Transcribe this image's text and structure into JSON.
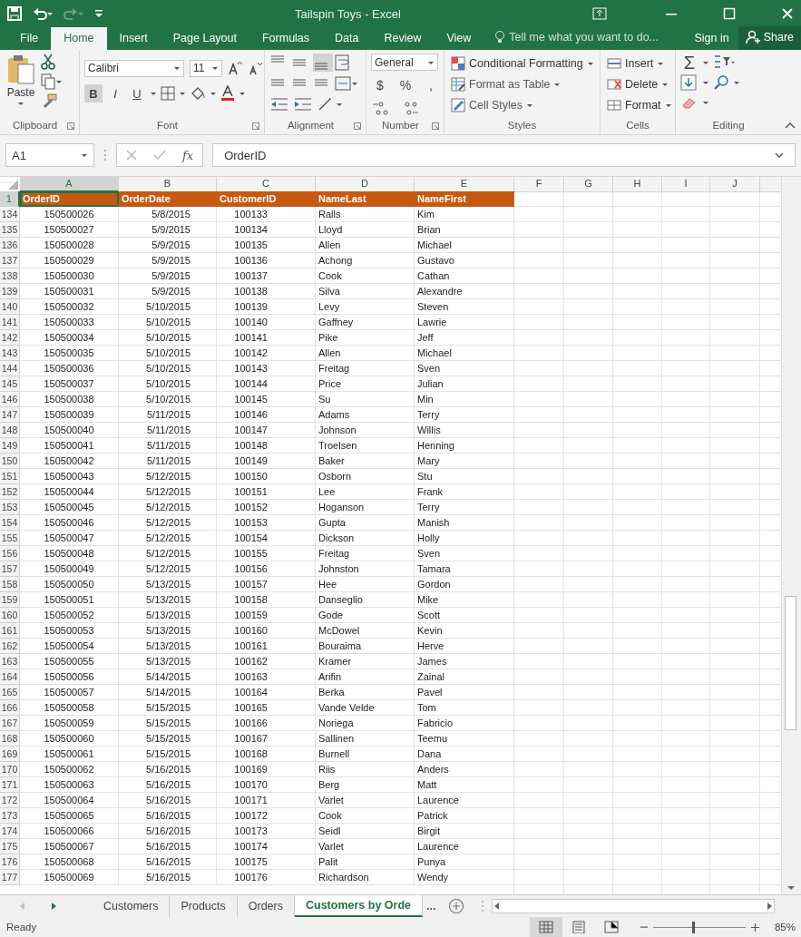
{
  "window": {
    "title": "Tailspin Toys - Excel"
  },
  "ribbon_tabs": [
    {
      "label": "File",
      "selected": false
    },
    {
      "label": "Home",
      "selected": true
    },
    {
      "label": "Insert",
      "selected": false
    },
    {
      "label": "Page Layout",
      "selected": false
    },
    {
      "label": "Formulas",
      "selected": false
    },
    {
      "label": "Data",
      "selected": false
    },
    {
      "label": "Review",
      "selected": false
    },
    {
      "label": "View",
      "selected": false
    }
  ],
  "tell_me": {
    "placeholder": "Tell me what you want to do..."
  },
  "account": {
    "sign_in": "Sign in",
    "share": "Share"
  },
  "ribbon": {
    "clipboard": {
      "paste": "Paste",
      "label": "Clipboard"
    },
    "font": {
      "name": "Calibri",
      "size": "11",
      "label": "Font",
      "styles": [
        {
          "label": "B",
          "selected": true
        },
        {
          "label": "I",
          "selected": false
        },
        {
          "label": "U",
          "selected": false
        }
      ]
    },
    "alignment": {
      "label": "Alignment",
      "vertical": [
        {
          "selected": false
        },
        {
          "selected": false
        },
        {
          "selected": true
        }
      ]
    },
    "number": {
      "format": "General",
      "symbols": [
        "$",
        "%",
        ","
      ],
      "label": "Number"
    },
    "styles": {
      "buttons": [
        "Conditional Formatting",
        "Format as Table",
        "Cell Styles"
      ],
      "label": "Styles"
    },
    "cells": {
      "buttons": [
        "Insert",
        "Delete",
        "Format"
      ],
      "label": "Cells"
    },
    "editing": {
      "sum": "Σ",
      "label": "Editing"
    }
  },
  "formula_bar": {
    "name_box": "A1",
    "fx": "fx",
    "value": "OrderID"
  },
  "sheet": {
    "columns": [
      {
        "label": "A",
        "selected": true
      },
      {
        "label": "B",
        "selected": false
      },
      {
        "label": "C",
        "selected": false
      },
      {
        "label": "D",
        "selected": false
      },
      {
        "label": "E",
        "selected": false
      },
      {
        "label": "F",
        "selected": false
      },
      {
        "label": "G",
        "selected": false
      },
      {
        "label": "H",
        "selected": false
      },
      {
        "label": "I",
        "selected": false
      },
      {
        "label": "J",
        "selected": false
      }
    ],
    "header_row": {
      "number": "1",
      "cells": [
        "OrderID",
        "OrderDate",
        "CustomerID",
        "NameLast",
        "NameFirst"
      ]
    },
    "rows": [
      {
        "number": "134",
        "cells": [
          "150500026",
          "5/8/2015",
          "100133",
          "Ralls",
          "Kim"
        ]
      },
      {
        "number": "135",
        "cells": [
          "150500027",
          "5/9/2015",
          "100134",
          "Lloyd",
          "Brian"
        ]
      },
      {
        "number": "136",
        "cells": [
          "150500028",
          "5/9/2015",
          "100135",
          "Allen",
          "Michael"
        ]
      },
      {
        "number": "137",
        "cells": [
          "150500029",
          "5/9/2015",
          "100136",
          "Achong",
          "Gustavo"
        ]
      },
      {
        "number": "138",
        "cells": [
          "150500030",
          "5/9/2015",
          "100137",
          "Cook",
          "Cathan"
        ]
      },
      {
        "number": "139",
        "cells": [
          "150500031",
          "5/9/2015",
          "100138",
          "Silva",
          "Alexandre"
        ]
      },
      {
        "number": "140",
        "cells": [
          "150500032",
          "5/10/2015",
          "100139",
          "Levy",
          "Steven"
        ]
      },
      {
        "number": "141",
        "cells": [
          "150500033",
          "5/10/2015",
          "100140",
          "Gaffney",
          "Lawrie"
        ]
      },
      {
        "number": "142",
        "cells": [
          "150500034",
          "5/10/2015",
          "100141",
          "Pike",
          "Jeff"
        ]
      },
      {
        "number": "143",
        "cells": [
          "150500035",
          "5/10/2015",
          "100142",
          "Allen",
          "Michael"
        ]
      },
      {
        "number": "144",
        "cells": [
          "150500036",
          "5/10/2015",
          "100143",
          "Freitag",
          "Sven"
        ]
      },
      {
        "number": "145",
        "cells": [
          "150500037",
          "5/10/2015",
          "100144",
          "Price",
          "Julian"
        ]
      },
      {
        "number": "146",
        "cells": [
          "150500038",
          "5/10/2015",
          "100145",
          "Su",
          "Min"
        ]
      },
      {
        "number": "147",
        "cells": [
          "150500039",
          "5/11/2015",
          "100146",
          "Adams",
          "Terry"
        ]
      },
      {
        "number": "148",
        "cells": [
          "150500040",
          "5/11/2015",
          "100147",
          "Johnson",
          "Willis"
        ]
      },
      {
        "number": "149",
        "cells": [
          "150500041",
          "5/11/2015",
          "100148",
          "Troelsen",
          "Henning"
        ]
      },
      {
        "number": "150",
        "cells": [
          "150500042",
          "5/11/2015",
          "100149",
          "Baker",
          "Mary"
        ]
      },
      {
        "number": "151",
        "cells": [
          "150500043",
          "5/12/2015",
          "100150",
          "Osborn",
          "Stu"
        ]
      },
      {
        "number": "152",
        "cells": [
          "150500044",
          "5/12/2015",
          "100151",
          "Lee",
          "Frank"
        ]
      },
      {
        "number": "153",
        "cells": [
          "150500045",
          "5/12/2015",
          "100152",
          "Hoganson",
          "Terry"
        ]
      },
      {
        "number": "154",
        "cells": [
          "150500046",
          "5/12/2015",
          "100153",
          "Gupta",
          "Manish"
        ]
      },
      {
        "number": "155",
        "cells": [
          "150500047",
          "5/12/2015",
          "100154",
          "Dickson",
          "Holly"
        ]
      },
      {
        "number": "156",
        "cells": [
          "150500048",
          "5/12/2015",
          "100155",
          "Freitag",
          "Sven"
        ]
      },
      {
        "number": "157",
        "cells": [
          "150500049",
          "5/12/2015",
          "100156",
          "Johnston",
          "Tamara"
        ]
      },
      {
        "number": "158",
        "cells": [
          "150500050",
          "5/13/2015",
          "100157",
          "Hee",
          "Gordon"
        ]
      },
      {
        "number": "159",
        "cells": [
          "150500051",
          "5/13/2015",
          "100158",
          "Danseglio",
          "Mike"
        ]
      },
      {
        "number": "160",
        "cells": [
          "150500052",
          "5/13/2015",
          "100159",
          "Gode",
          "Scott"
        ]
      },
      {
        "number": "161",
        "cells": [
          "150500053",
          "5/13/2015",
          "100160",
          "McDowel",
          "Kevin"
        ]
      },
      {
        "number": "162",
        "cells": [
          "150500054",
          "5/13/2015",
          "100161",
          "Bouraima",
          "Herve"
        ]
      },
      {
        "number": "163",
        "cells": [
          "150500055",
          "5/13/2015",
          "100162",
          "Kramer",
          "James"
        ]
      },
      {
        "number": "164",
        "cells": [
          "150500056",
          "5/14/2015",
          "100163",
          "Arifin",
          "Zainal"
        ]
      },
      {
        "number": "165",
        "cells": [
          "150500057",
          "5/14/2015",
          "100164",
          "Berka",
          "Pavel"
        ]
      },
      {
        "number": "166",
        "cells": [
          "150500058",
          "5/15/2015",
          "100165",
          "Vande Velde",
          "Tom"
        ]
      },
      {
        "number": "167",
        "cells": [
          "150500059",
          "5/15/2015",
          "100166",
          "Noriega",
          "Fabricio"
        ]
      },
      {
        "number": "168",
        "cells": [
          "150500060",
          "5/15/2015",
          "100167",
          "Sallinen",
          "Teemu"
        ]
      },
      {
        "number": "169",
        "cells": [
          "150500061",
          "5/15/2015",
          "100168",
          "Burnell",
          "Dana"
        ]
      },
      {
        "number": "170",
        "cells": [
          "150500062",
          "5/16/2015",
          "100169",
          "Riis",
          "Anders"
        ]
      },
      {
        "number": "171",
        "cells": [
          "150500063",
          "5/16/2015",
          "100170",
          "Berg",
          "Matt"
        ]
      },
      {
        "number": "172",
        "cells": [
          "150500064",
          "5/16/2015",
          "100171",
          "Varlet",
          "Laurence"
        ]
      },
      {
        "number": "173",
        "cells": [
          "150500065",
          "5/16/2015",
          "100172",
          "Cook",
          "Patrick"
        ]
      },
      {
        "number": "174",
        "cells": [
          "150500066",
          "5/16/2015",
          "100173",
          "Seidl",
          "Birgit"
        ]
      },
      {
        "number": "175",
        "cells": [
          "150500067",
          "5/16/2015",
          "100174",
          "Varlet",
          "Laurence"
        ]
      },
      {
        "number": "176",
        "cells": [
          "150500068",
          "5/16/2015",
          "100175",
          "Palit",
          "Punya"
        ]
      },
      {
        "number": "177",
        "cells": [
          "150500069",
          "5/16/2015",
          "100176",
          "Richardson",
          "Wendy"
        ]
      }
    ]
  },
  "sheet_tabs": [
    {
      "label": "Customers",
      "selected": false
    },
    {
      "label": "Products",
      "selected": false
    },
    {
      "label": "Orders",
      "selected": false
    },
    {
      "label": "Customers by Orde",
      "selected": true
    }
  ],
  "more_tabs": "...",
  "status_bar": {
    "status": "Ready",
    "views": [
      {
        "selected": true
      },
      {
        "selected": false
      },
      {
        "selected": false
      }
    ],
    "zoom": {
      "level": 0.43,
      "reading": "85%"
    }
  }
}
